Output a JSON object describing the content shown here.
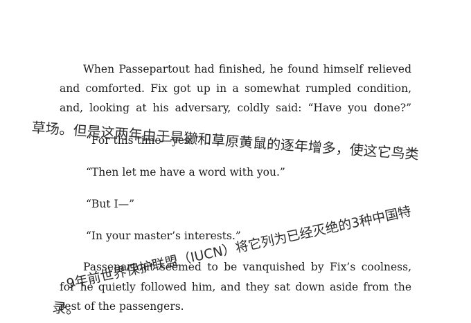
{
  "printed_text": {
    "p1_l1": "When Passepartout had finished, he found himself relieved",
    "p1_l2": "and comforted. Fix got up in a somewhat rumpled condition,",
    "p1_l3": "and, looking at his adversary, coldly said: “Have you done?”",
    "q1": "“For this time—yes.”",
    "q2": "“Then let me have a word with you.”",
    "q3": "“But I—”",
    "q4": "“In your master’s interests.”",
    "p2_l1": "Passepartout seemed to be vanquished by Fix’s coolness,",
    "p2_l2": "for he quietly followed him, and they sat down aside from the",
    "p2_l3": "rest of the passengers."
  },
  "handwriting": {
    "h1": "草场。但是这两年由于旱獭和草原黄鼠的逐年增多，使这它鸟类",
    "h2": "9年前世界保护联盟（IUCN）将它列为已经灭绝的3种中国特",
    "h3": "录。"
  }
}
